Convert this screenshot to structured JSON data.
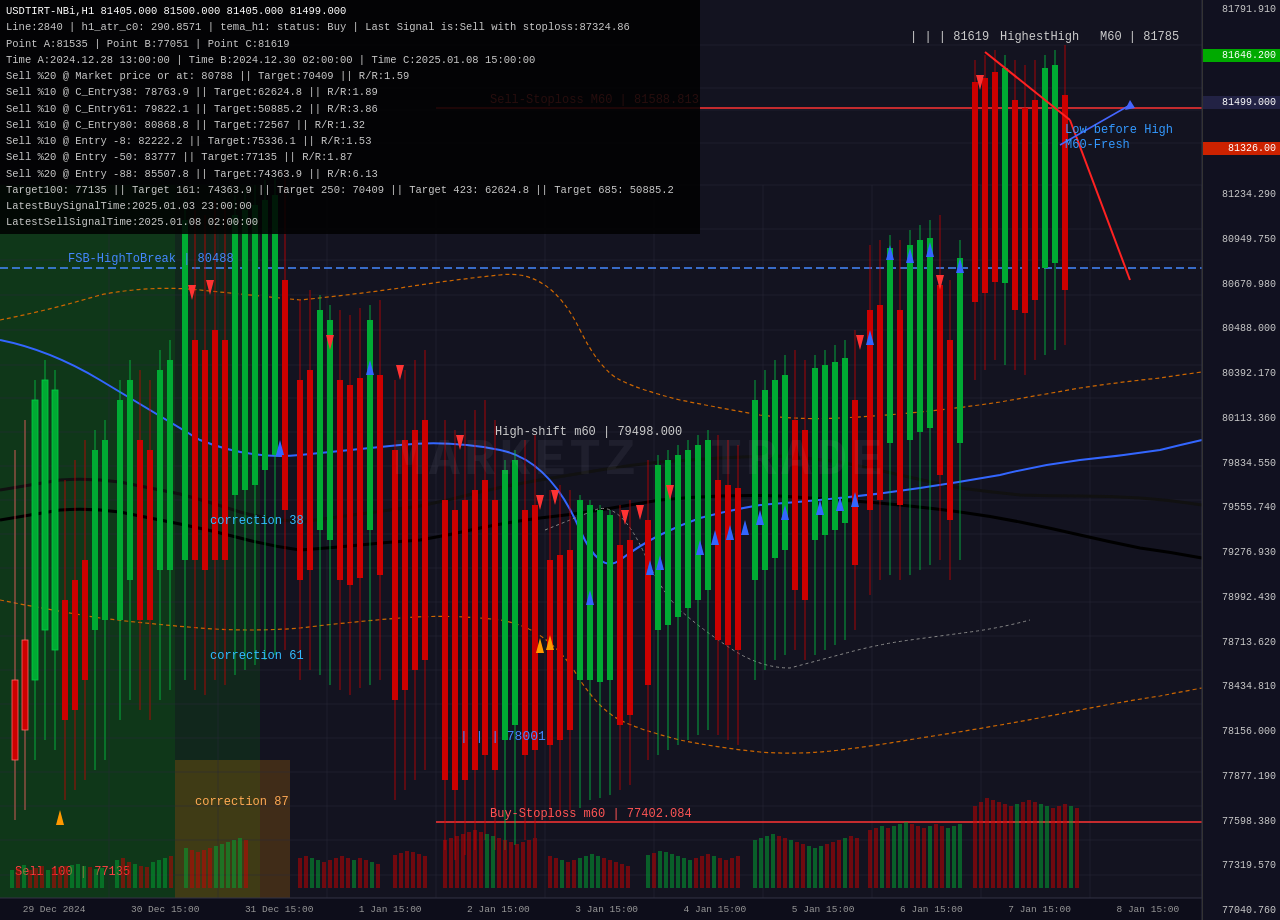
{
  "chart": {
    "title": "USDTIRT-NBi,H1",
    "prices": {
      "open": "81405.000",
      "high": "81500.000",
      "close": "81405.000",
      "last": "81499.000"
    },
    "info_lines": [
      "USDTIRT-NBi,H1  81405.000  81500.000  81405.000  81499.000",
      "Line:2840  |  h1_atr_c0: 290.8571  |  tema_h1: status: Buy  |  Last Signal is:Sell with stoploss:87324.86",
      "Point A:81535  |  Point B:77051  |  Point C:81619",
      "Time A:2024.12.28 13:00:00  |  Time B:2024.12.30 02:00:00  |  Time C:2025.01.08 15:00:00",
      "Sell %20 @ Market price or at: 80788  ||  Target:70409  ||  R/R:1.59",
      "Sell %10 @ C_Entry38: 78763.9  ||  Target:62624.8  ||  R/R:1.89",
      "Sell %10 @ C_Entry61: 79822.1  ||  Target:50885.2  ||  R/R:3.86",
      "Sell %10 @ C_Entry80: 80868.8  ||  Target:72567  ||  R/R:1.32",
      "Sell %10 @ Entry -8: 82222.2  ||  Target:75336.1  ||  R/R:1.53",
      "Sell %20 @ Entry -50: 83777  ||  Target:77135  ||  R/R:1.87",
      "Sell %20 @ Entry -88: 85507.8  ||  Target:74363.9  ||  R/R:6.13",
      "Target100: 77135  ||  Target 161: 74363.9  ||  Target 250: 70409  ||  Target 423: 62624.8  ||  Target 685: 50885.2",
      "LatestBuySignalTime:2025.01.03 23:00:00",
      "LatestSellSignalTime:2025.01.08 02:00:00"
    ],
    "labels": {
      "highest_high": "| | | 81619  HighestHigh    M60 | 81785",
      "low_before_high": "Low before High    M60-Fresh",
      "fsb_high": "FSB-HighToBreak | 80488",
      "sell_stoploss": "Sell-Stoploss M60 | 81588.813",
      "high_shift": "High-shift m60 | 79498.000",
      "low_level": "| | | 78001",
      "buy_stoploss": "Buy-Stoploss m60 | 77402.084",
      "sell_100": "Sell 100 | 77135",
      "correction_38": "correction 38",
      "correction_61": "correction 61",
      "correction_87": "correction 87"
    },
    "price_axis": [
      {
        "value": "81791.910",
        "type": "normal"
      },
      {
        "value": "81646.200",
        "type": "green"
      },
      {
        "value": "81499.000",
        "type": "dark"
      },
      {
        "value": "81326.00",
        "type": "red"
      },
      {
        "value": "81234.290",
        "type": "normal"
      },
      {
        "value": "80949.750",
        "type": "normal"
      },
      {
        "value": "80670.980",
        "type": "normal"
      },
      {
        "value": "80488.000",
        "type": "normal"
      },
      {
        "value": "80392.170",
        "type": "normal"
      },
      {
        "value": "80113.360",
        "type": "normal"
      },
      {
        "value": "79834.550",
        "type": "normal"
      },
      {
        "value": "79555.740",
        "type": "normal"
      },
      {
        "value": "79276.930",
        "type": "normal"
      },
      {
        "value": "78992.430",
        "type": "normal"
      },
      {
        "value": "78713.620",
        "type": "normal"
      },
      {
        "value": "78434.810",
        "type": "normal"
      },
      {
        "value": "78156.000",
        "type": "normal"
      },
      {
        "value": "77877.190",
        "type": "normal"
      },
      {
        "value": "77598.380",
        "type": "normal"
      },
      {
        "value": "77319.570",
        "type": "normal"
      },
      {
        "value": "77040.760",
        "type": "normal"
      }
    ],
    "time_axis": [
      "29 Dec 2024",
      "30 Dec 15:00",
      "31 Dec 15:00",
      "1 Jan 15:00",
      "2 Jan 15:00",
      "3 Jan 15:00",
      "4 Jan 15:00",
      "5 Jan 15:00",
      "6 Jan 15:00",
      "7 Jan 15:00",
      "8 Jan 15:00"
    ],
    "watermark": "MARKETZ  TRADE"
  }
}
